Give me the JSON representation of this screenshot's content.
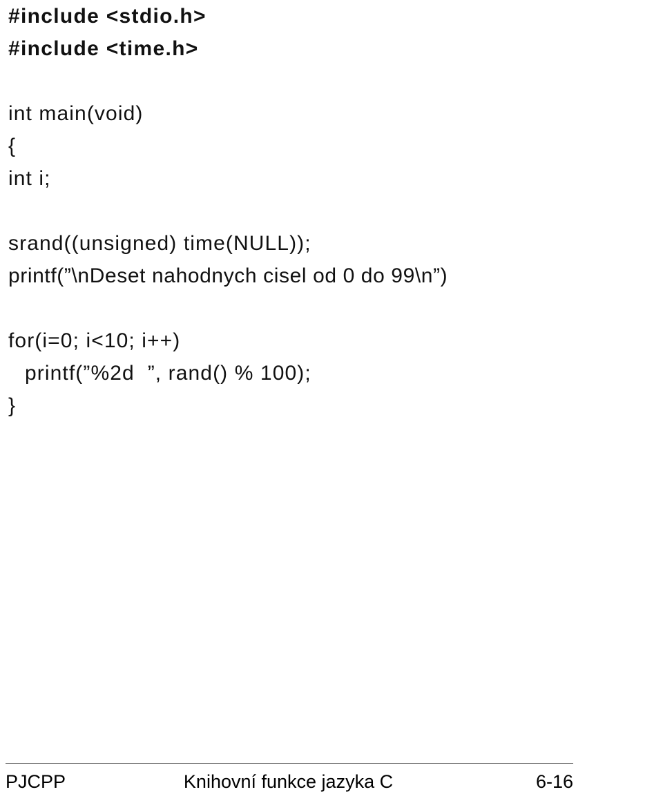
{
  "slide": {
    "code_lines": [
      {
        "text": "#include <stdio.h>",
        "style": "bold",
        "indent": 0
      },
      {
        "text": "#include <time.h>",
        "style": "bold",
        "indent": 0
      },
      {
        "text": "",
        "style": "blank",
        "indent": 0
      },
      {
        "text": "int main(void)",
        "style": "normal",
        "indent": 0
      },
      {
        "text": "{",
        "style": "normal",
        "indent": 0
      },
      {
        "text": "int i;",
        "style": "normal",
        "indent": 0
      },
      {
        "text": "",
        "style": "blank",
        "indent": 0
      },
      {
        "text": "srand((unsigned) time(NULL));",
        "style": "normal",
        "indent": 0
      },
      {
        "text": "printf(”\\nDeset nahodnych cisel od 0 do 99\\n”)",
        "style": "tight",
        "indent": 0
      },
      {
        "text": "",
        "style": "blank",
        "indent": 0
      },
      {
        "text": "for(i=0; i<10; i++)",
        "style": "normal",
        "indent": 0
      },
      {
        "text": "printf(”%2d  ”, rand() % 100);",
        "style": "normal",
        "indent": 1
      },
      {
        "text": "}",
        "style": "normal",
        "indent": 0
      }
    ]
  },
  "footer": {
    "left": "PJCPP",
    "center": "Knihovní funkce jazyka C",
    "right": "6-16"
  },
  "colors": {
    "background": "#ffffff",
    "text": "#000000",
    "code_text": "#111111",
    "footer_rule": "#555555"
  }
}
